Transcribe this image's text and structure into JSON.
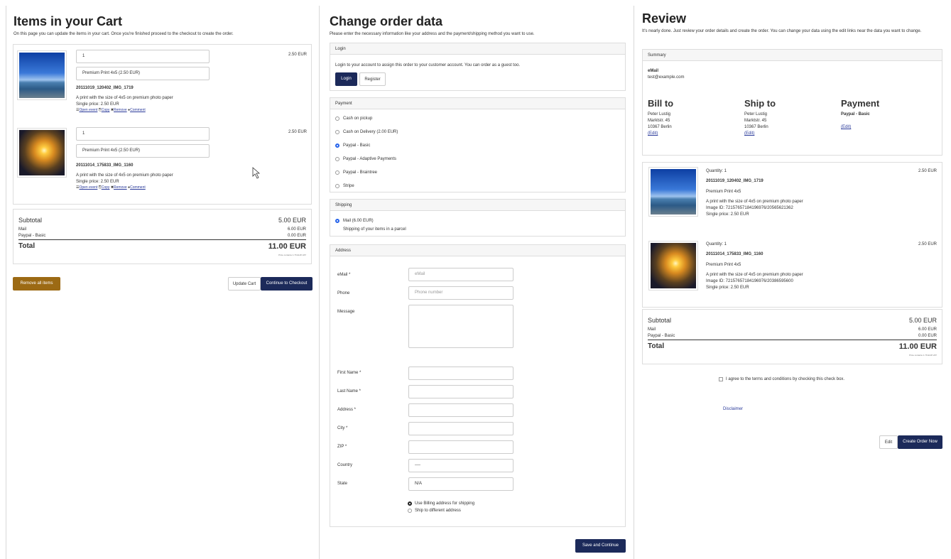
{
  "cart": {
    "title": "Items in your Cart",
    "lead": "On this page you can update the items in your cart. Once you're finished proceed to the checkout to create the order.",
    "items": [
      {
        "quantity": "1",
        "product": "Premium Print 4x5 (2.50 EUR)",
        "price": "2.50 EUR",
        "name": "20111019_120402_IMG_1719",
        "description": "A print with the size of 4x5 on premium photo paper",
        "single_price": "Single price: 2.50 EUR",
        "image": "beach-photo"
      },
      {
        "quantity": "1",
        "product": "Premium Print 4x5 (2.50 EUR)",
        "price": "2.50 EUR",
        "name": "20111014_175833_IMG_1160",
        "description": "A print with the size of 4x5 on premium photo paper",
        "single_price": "Single price: 2.50 EUR",
        "image": "sunset-photo"
      }
    ],
    "actions": {
      "open_event": "Open event",
      "copy": "Copy",
      "remove": "Remove",
      "comment": "Comment"
    },
    "totals": {
      "subtotal_label": "Subtotal",
      "subtotal": "5.00 EUR",
      "mail_label": "Mail",
      "mail": "6.00 EUR",
      "paypal_label": "Paypal - Basic",
      "paypal": "0.00 EUR",
      "total_label": "Total",
      "total": "11.00 EUR",
      "vat": "Price contains 1.76 EUR VAT"
    },
    "remove_all": "Remove all items",
    "update_cart": "Update Cart",
    "continue": "Continue to Checkout"
  },
  "order": {
    "title": "Change order data",
    "lead": "Please enter the necessary information like your address and the payment/shipping method you want to use.",
    "login": {
      "header": "Login",
      "text": "Login to your account to assign this order to your customer account. You can order as a guest too.",
      "login_btn": "Login",
      "register_btn": "Register"
    },
    "payment": {
      "header": "Payment",
      "options": [
        "Cash on pickup",
        "Cash on Delivery (2.00 EUR)",
        "Paypal - Basic",
        "Paypal - Adaptive Payments",
        "Paypal - Braintree",
        "Stripe"
      ],
      "selected": "Paypal - Basic"
    },
    "shipping": {
      "header": "Shipping",
      "option": "Mail (6.00 EUR)",
      "description": "Shipping of your items in a parcel"
    },
    "address": {
      "header": "Address",
      "email_label": "eMail *",
      "email_placeholder": "eMail",
      "phone_label": "Phone",
      "phone_placeholder": "Phone number",
      "message_label": "Message",
      "first_name_label": "First Name *",
      "last_name_label": "Last Name *",
      "address_label": "Address *",
      "city_label": "City *",
      "zip_label": "ZIP *",
      "country_label": "Country",
      "country_value": "----",
      "state_label": "State",
      "state_value": "N/A",
      "use_billing": "Use Billing address for shipping",
      "ship_different": "Ship to different address"
    },
    "save": "Save and Continue"
  },
  "review": {
    "title": "Review",
    "lead": "It's nearly done. Just review your order details and create the order. You can change your data using the edit links near the data you want to change.",
    "summary_header": "Summary",
    "email_label": "eMail",
    "email": "test@example.com",
    "bill_to": {
      "heading": "Bill to",
      "name": "Peter Lustig",
      "street": "Marktstr. 45",
      "city": "10367 Berlin",
      "edit": "(Edit)"
    },
    "ship_to": {
      "heading": "Ship to",
      "name": "Peter Lustig",
      "street": "Marktstr. 45",
      "city": "10367 Berlin",
      "edit": "(Edit)"
    },
    "payment": {
      "heading": "Payment",
      "method": "Paypal - Basic",
      "edit": "(Edit)"
    },
    "items": [
      {
        "quantity": "Quantity: 1",
        "price": "2.50 EUR",
        "name": "20111019_120402_IMG_1719",
        "product": "Premium Print 4x5",
        "description": "A print with the size of 4x5 on premium photo paper",
        "image_id": "Image ID: 72157657184196976/20565621362",
        "single_price": "Single price: 2.50 EUR"
      },
      {
        "quantity": "Quantity: 1",
        "price": "2.50 EUR",
        "name": "20111014_175833_IMG_1160",
        "product": "Premium Print 4x5",
        "description": "A print with the size of 4x5 on premium photo paper",
        "image_id": "Image ID: 72157657184196976/20386595600",
        "single_price": "Single price: 2.50 EUR"
      }
    ],
    "totals": {
      "subtotal_label": "Subtotal",
      "subtotal": "5.00 EUR",
      "mail_label": "Mail",
      "mail": "6.00 EUR",
      "paypal_label": "Paypal - Basic",
      "paypal": "0.00 EUR",
      "total_label": "Total",
      "total": "11.00 EUR",
      "vat": "Price contains 1.76 EUR VAT"
    },
    "terms": "I agree to the terms and conditions by checking this check box.",
    "disclaimer": "Disclaimer",
    "edit_btn": "Edit",
    "create_btn": "Create Order Now"
  }
}
